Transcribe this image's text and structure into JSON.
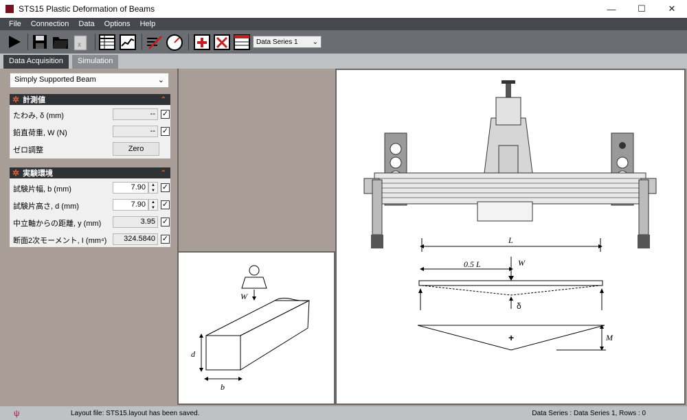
{
  "window": {
    "title": "STS15 Plastic Deformation of Beams",
    "minimize": "—",
    "maximize": "☐",
    "close": "✕"
  },
  "menu": [
    "File",
    "Connection",
    "Data",
    "Options",
    "Help"
  ],
  "toolbar": {
    "series_select": "Data Series 1",
    "icons": [
      "play-icon",
      "save-icon",
      "open-folder-icon",
      "excel-export-icon",
      "table-view-icon",
      "graph-view-icon",
      "edit-chart-icon",
      "gauge-icon",
      "add-series-icon",
      "delete-series-icon",
      "series-table-icon"
    ]
  },
  "tabs": [
    "Data Acquisition",
    "Simulation"
  ],
  "left": {
    "beam_type": "Simply Supported Beam",
    "measure": {
      "header": "計測値",
      "deflection_label": "たわみ, δ (mm)",
      "deflection_value": "--",
      "load_label": "鉛直荷重, W (N)",
      "load_value": "--",
      "zero_label": "ゼロ調整",
      "zero_button": "Zero"
    },
    "env": {
      "header": "実験環境",
      "width_label": "試験片幅, b (mm)",
      "width_value": "7.90",
      "height_label": "試験片高さ, d (mm)",
      "height_value": "7.90",
      "neutral_label": "中立軸からの距離, y (mm)",
      "neutral_value": "3.95",
      "moment_label": "断面2次モーメント, I (mm⁴)",
      "moment_value": "324.5840"
    }
  },
  "specimen_diagram": {
    "W": "W",
    "d": "d",
    "b": "b"
  },
  "beam_diagram": {
    "L": "L",
    "half_L": "0.5 L",
    "W": "W",
    "delta": "δ",
    "plus": "+",
    "M": "M"
  },
  "status": {
    "icon": "usb-icon",
    "message": "Layout file: STS15.layout has been saved.",
    "series_info": "Data Series : Data Series 1,  Rows : 0"
  }
}
